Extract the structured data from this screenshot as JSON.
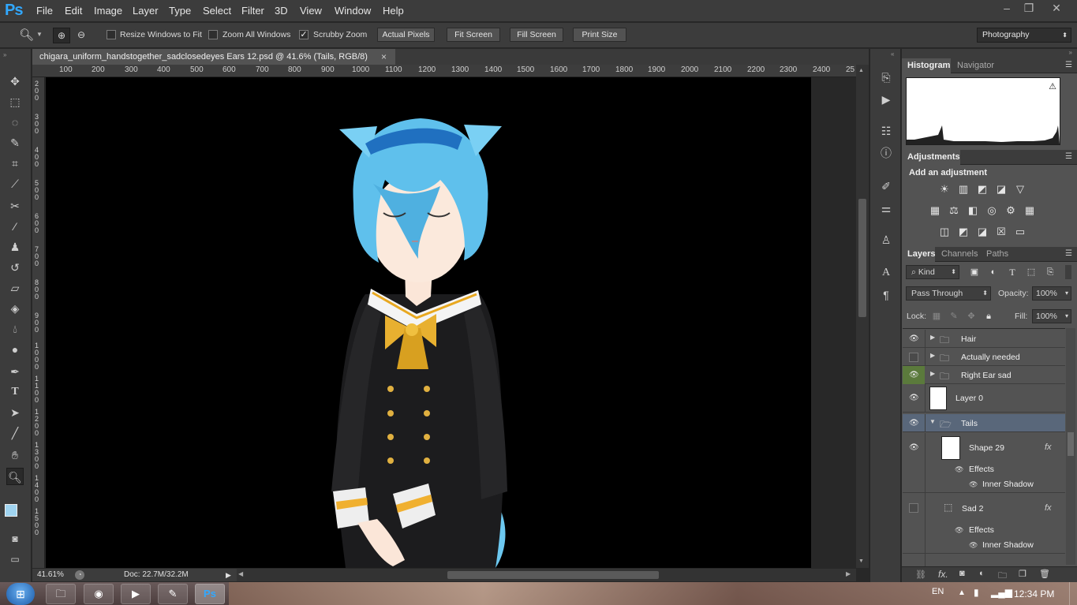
{
  "app": {
    "logo": "Ps"
  },
  "menu": [
    "File",
    "Edit",
    "Image",
    "Layer",
    "Type",
    "Select",
    "Filter",
    "3D",
    "View",
    "Window",
    "Help"
  ],
  "window_controls": {
    "minimize": "–",
    "restore": "❐",
    "close": "✕"
  },
  "options": {
    "resize_windows": "Resize Windows to Fit",
    "zoom_all": "Zoom All Windows",
    "scrubby_zoom": "Scrubby Zoom",
    "actual_pixels": "Actual Pixels",
    "fit_screen": "Fit Screen",
    "fill_screen": "Fill Screen",
    "print_size": "Print Size",
    "workspace": "Photography",
    "resize_checked": false,
    "zoom_all_checked": false,
    "scrubby_checked": true
  },
  "document": {
    "tab_title": "chigara_uniform_handstogether_sadclosedeyes Ears 12.psd @ 41.6% (Tails, RGB/8)",
    "close": "×",
    "ruler_h": [
      "100",
      "200",
      "300",
      "400",
      "500",
      "600",
      "700",
      "800",
      "900",
      "1000",
      "1100",
      "1200",
      "1300",
      "1400",
      "1500",
      "1600",
      "1700",
      "1800",
      "1900",
      "2000",
      "2100",
      "2200",
      "2300",
      "2400",
      "25"
    ],
    "ruler_v": [
      "200",
      "300",
      "400",
      "500",
      "600",
      "700",
      "800",
      "900",
      "1000",
      "1100",
      "1200",
      "1300",
      "1400",
      "1500"
    ]
  },
  "status": {
    "zoom": "41.61%",
    "doc": "Doc: 22.7M/32.2M"
  },
  "panels": {
    "top_tabs": [
      "Histogram",
      "Navigator"
    ],
    "adjustments_title": "Adjustments",
    "add_adjustment": "Add an adjustment",
    "layer_tabs": [
      "Layers",
      "Channels",
      "Paths"
    ],
    "kind": "Kind",
    "blend_mode": "Pass Through",
    "opacity_label": "Opacity:",
    "opacity": "100%",
    "lock_label": "Lock:",
    "fill_label": "Fill:",
    "fill": "100%"
  },
  "layers": [
    {
      "name": "Hair",
      "type": "group",
      "visible": true
    },
    {
      "name": "Actually needed",
      "type": "group",
      "visible": false
    },
    {
      "name": "Right Ear sad",
      "type": "group",
      "visible": true
    },
    {
      "name": "Layer 0",
      "type": "layer",
      "visible": true
    },
    {
      "name": "Tails",
      "type": "group-open",
      "visible": true,
      "selected": true
    },
    {
      "name": "Shape 29",
      "type": "shape",
      "visible": true,
      "fx": "fx"
    },
    {
      "name": "Effects",
      "type": "effect"
    },
    {
      "name": "Inner Shadow",
      "type": "effect-item"
    },
    {
      "name": "Sad 2",
      "type": "shape",
      "visible": false,
      "fx": "fx"
    },
    {
      "name": "Effects",
      "type": "effect"
    },
    {
      "name": "Inner Shadow",
      "type": "effect-item"
    }
  ],
  "taskbar": {
    "lang": "EN",
    "time": "12:34 PM"
  },
  "colors": {
    "accent": "#31a8ff",
    "panel_bg": "#535353",
    "chrome": "#3c3c3c",
    "selected_layer": "#59677a"
  }
}
